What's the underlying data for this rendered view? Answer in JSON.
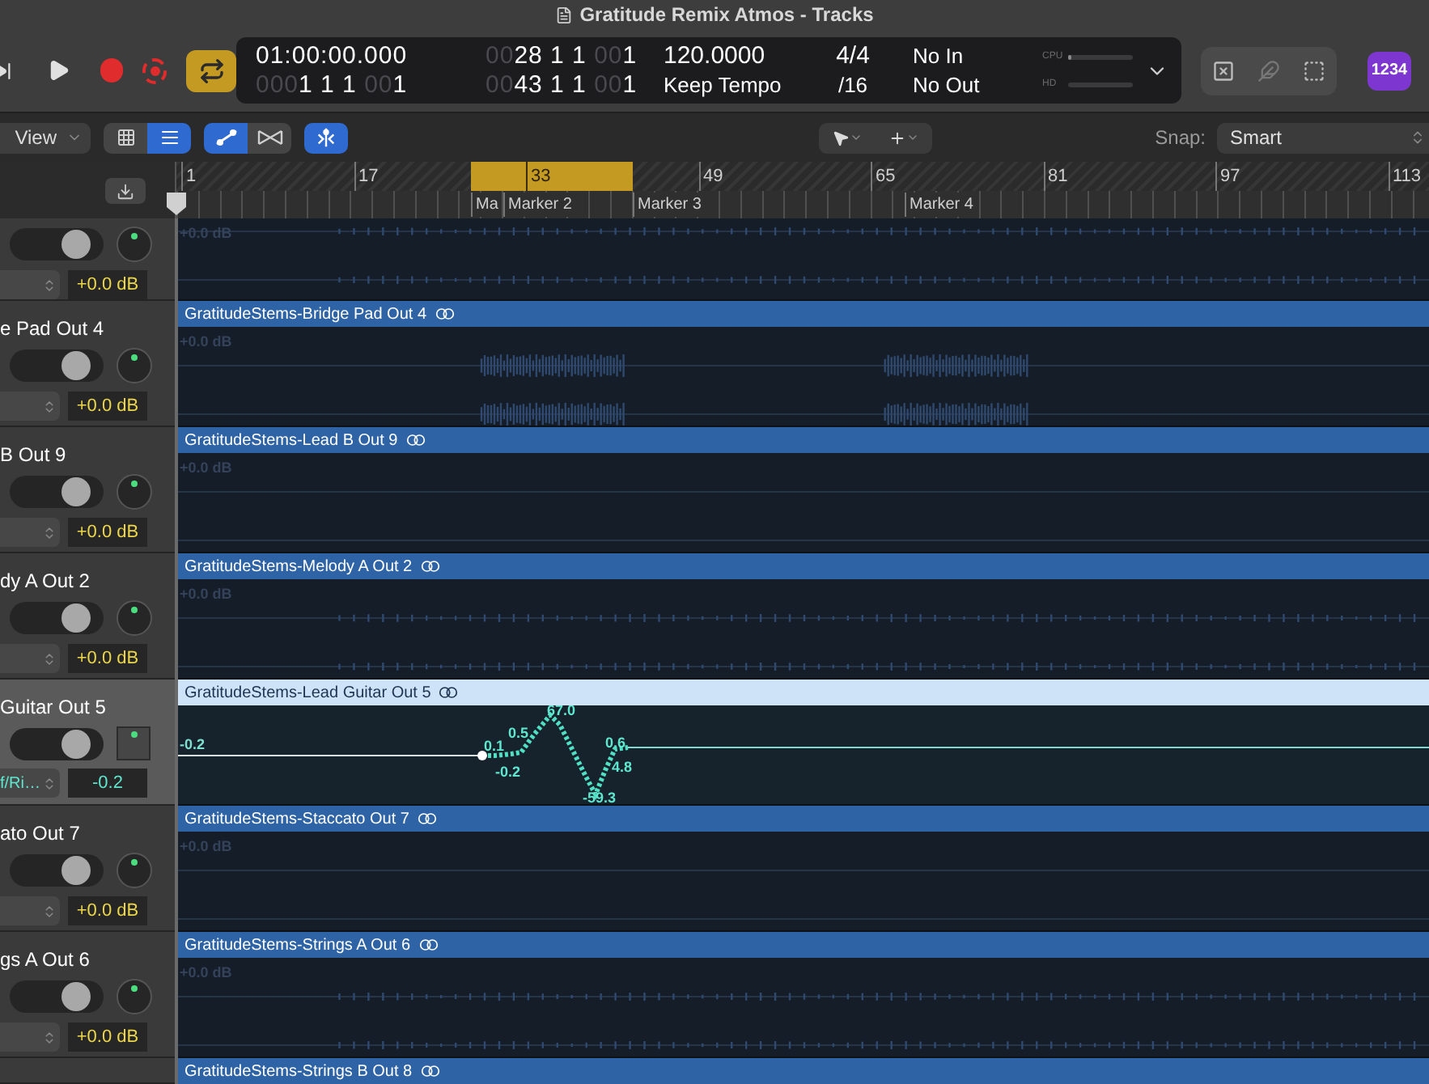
{
  "window": {
    "title": "Gratitude Remix Atmos - Tracks"
  },
  "transport": {
    "cycle_on": true
  },
  "lcd": {
    "time": "01:00:00.000",
    "time_sub": {
      "zeros": "000",
      "value": "1 1 1 ",
      "tick_zeros": "00",
      "tick": "1"
    },
    "bars_top": {
      "zeros": "00",
      "value": "28 1 1 ",
      "tick_zeros": "00",
      "tick": "1"
    },
    "bars_bottom": {
      "zeros": "00",
      "value": "43 1 1 ",
      "tick_zeros": "00",
      "tick": "1"
    },
    "tempo": "120.0000",
    "tempo_mode": "Keep Tempo",
    "signature": "4/4",
    "division": "/16",
    "input": "No In",
    "output": "No Out",
    "meters": [
      {
        "label": "CPU",
        "level": 0.04
      },
      {
        "label": "HD"
      }
    ]
  },
  "badge": "1234",
  "toolbar": {
    "view_menu": "View",
    "view_buttons": [
      {
        "kind": "grid",
        "selected": false
      },
      {
        "kind": "list",
        "selected": true
      }
    ],
    "edit_buttons": [
      {
        "kind": "automation",
        "selected": true
      },
      {
        "kind": "flex",
        "selected": false
      }
    ],
    "catch_button": {
      "selected": true
    },
    "snap_label": "Snap:",
    "snap_value": "Smart"
  },
  "ruler": {
    "bars": [
      "1",
      "17",
      "33",
      "49",
      "65",
      "81",
      "97",
      "113"
    ],
    "markers": [
      "Ma",
      "Marker 2",
      "Marker 3",
      "Marker 4"
    ]
  },
  "tracks": [
    {
      "selected": false,
      "automation": false,
      "value": "+0.0 dB",
      "lane_label": "+0.0 dB"
    },
    {
      "name": "e Pad Out 4",
      "region": "GratitudeStems-Bridge Pad Out 4",
      "selected": false,
      "automation": false,
      "value": "+0.0 dB",
      "lane_label": "+0.0 dB"
    },
    {
      "name": "B Out 9",
      "region": "GratitudeStems-Lead B Out 9",
      "selected": false,
      "automation": false,
      "value": "+0.0 dB",
      "lane_label": "+0.0 dB"
    },
    {
      "name": "dy A Out 2",
      "region": "GratitudeStems-Melody A Out 2",
      "selected": false,
      "automation": false,
      "value": "+0.0 dB",
      "lane_label": "+0.0 dB"
    },
    {
      "name": "Guitar Out 5",
      "region": "GratitudeStems-Lead Guitar Out 5",
      "selected": true,
      "automation": true,
      "parameter": "f/Ri…",
      "value": "-0.2",
      "lane_label": "-0.2",
      "point_labels": [
        "0.1",
        "0.5",
        "-0.2",
        "67.0",
        "0.6",
        "4.8",
        "-59.3"
      ]
    },
    {
      "name": "ato Out 7",
      "region": "GratitudeStems-Staccato Out 7",
      "selected": false,
      "automation": false,
      "value": "+0.0 dB",
      "lane_label": "+0.0 dB"
    },
    {
      "name": "gs A Out 6",
      "region": "GratitudeStems-Strings A Out 6",
      "selected": false,
      "automation": false,
      "value": "+0.0 dB",
      "lane_label": "+0.0 dB"
    },
    {
      "region": "GratitudeStems-Strings B Out 8",
      "selected": false,
      "automation": false
    }
  ]
}
